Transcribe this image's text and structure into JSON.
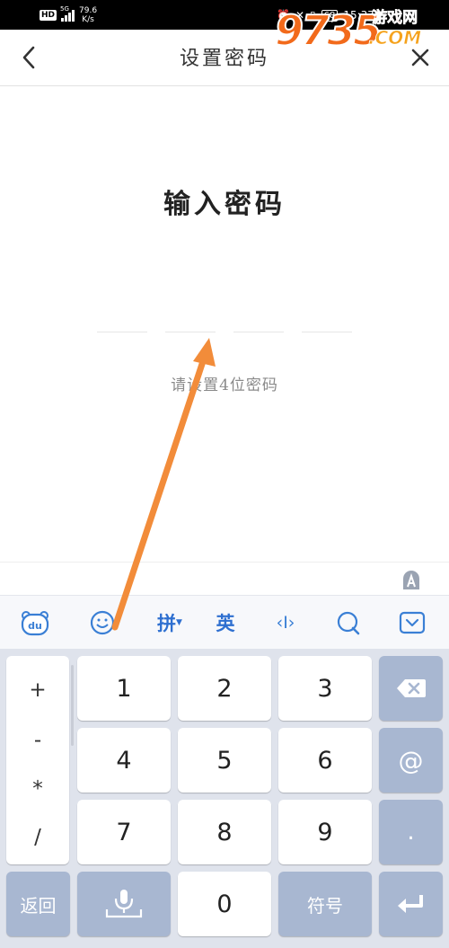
{
  "status_bar": {
    "hd": "HD",
    "network": "5G",
    "speed_value": "79.6",
    "speed_unit": "K/s",
    "battery": "68",
    "time": "15:37"
  },
  "watermark": {
    "digits": "9735",
    "cn": "游戏网",
    "com": ".COM"
  },
  "nav": {
    "title": "设置密码"
  },
  "content": {
    "heading": "输入密码",
    "hint": "请设置4位密码"
  },
  "toolbar": {
    "pinyin": "拼",
    "english": "英",
    "cursor": "‹I›"
  },
  "keyboard": {
    "symbols": [
      "+",
      "-",
      "*",
      "/"
    ],
    "digits": [
      "1",
      "2",
      "3",
      "4",
      "5",
      "6",
      "7",
      "8",
      "9",
      "0"
    ],
    "at": "@",
    "dot": ".",
    "return_label": "返回",
    "symbol_label": "符号"
  },
  "colors": {
    "accent": "#2e6fd0",
    "func_key": "#a8b7d1",
    "keyboard_bg": "#dfe3ec",
    "arrow": "#f28c3a"
  }
}
